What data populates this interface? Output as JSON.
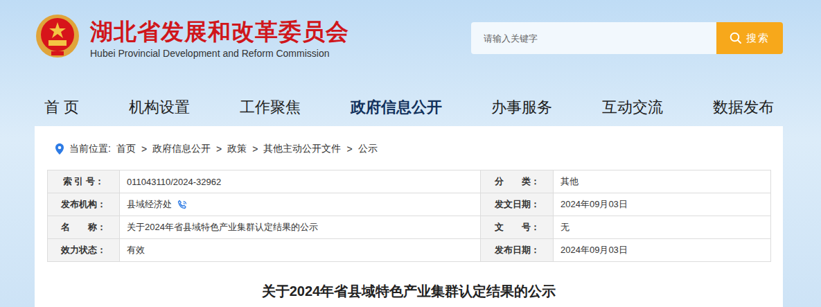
{
  "header": {
    "title": "湖北省发展和改革委员会",
    "subtitle": "Hubei Provincial Development and Reform Commission"
  },
  "search": {
    "placeholder": "请输入关键字",
    "button": "搜索"
  },
  "nav": [
    {
      "label": "首 页",
      "selected": false
    },
    {
      "label": "机构设置",
      "selected": false
    },
    {
      "label": "工作聚焦",
      "selected": false
    },
    {
      "label": "政府信息公开",
      "selected": true
    },
    {
      "label": "办事服务",
      "selected": false
    },
    {
      "label": "互动交流",
      "selected": false
    },
    {
      "label": "数据发布",
      "selected": false
    }
  ],
  "breadcrumb": {
    "label": "当前位置:",
    "separator": ">",
    "items": [
      "首页",
      "政府信息公开",
      "政策",
      "其他主动公开文件",
      "公示"
    ]
  },
  "table": {
    "rows": [
      [
        {
          "label": "索 引 号：",
          "value": "011043110/2024-32962",
          "kind": "text"
        },
        {
          "label": "分　　类：",
          "value": "其他",
          "kind": "text"
        }
      ],
      [
        {
          "label": "发布机构：",
          "value": "县域经济处",
          "kind": "contact"
        },
        {
          "label": "发文日期：",
          "value": "2024年09月03日",
          "kind": "text"
        }
      ],
      [
        {
          "label": "名　　称：",
          "value": "关于2024年省县域特色产业集群认定结果的公示",
          "kind": "text"
        },
        {
          "label": "文　　号：",
          "value": "无",
          "kind": "text"
        }
      ],
      [
        {
          "label": "效力状态：",
          "value": "有效",
          "kind": "text"
        },
        {
          "label": "发布日期：",
          "value": "2024年09月03日",
          "kind": "text"
        }
      ]
    ]
  },
  "heading": "关于2024年省县域特色产业集群认定结果的公示"
}
